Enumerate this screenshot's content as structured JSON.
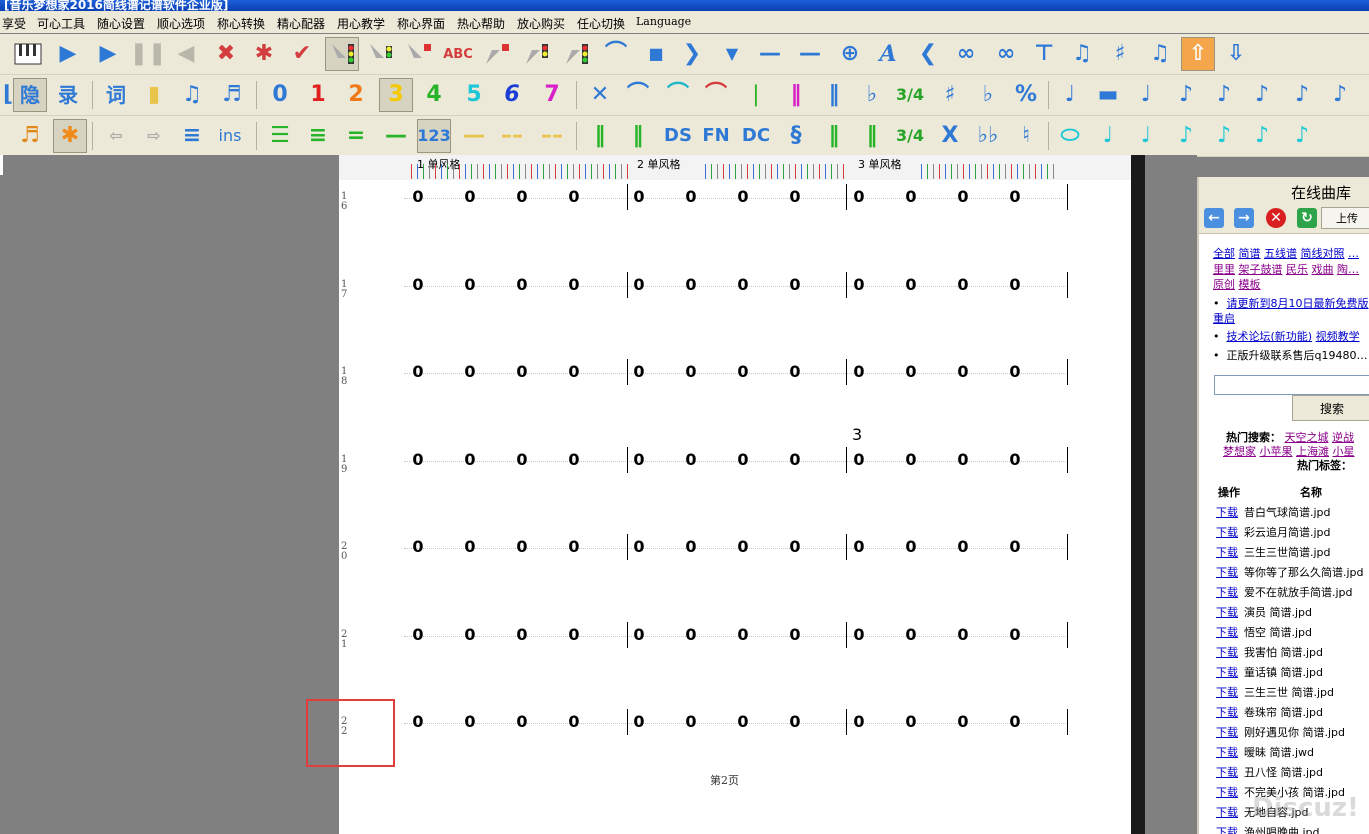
{
  "window_title": "[音乐梦想家2016简线谱记谱软件企业版]",
  "menu": [
    "享受",
    "可心工具",
    "随心设置",
    "顺心选项",
    "称心转换",
    "精心配器",
    "用心教学",
    "称心界面",
    "热心帮助",
    "放心购买",
    "任心切换",
    "Language"
  ],
  "toolbar_text": {
    "note_digits": [
      "0",
      "1",
      "2",
      "3",
      "4",
      "5",
      "6",
      "7"
    ],
    "yin_label": "隐",
    "lu_label": "录",
    "ci_label": "词",
    "ins_label": "ins",
    "num_label": "123",
    "abc_label": "ABC",
    "ds_label": "DS",
    "fn_label": "FN",
    "dc_label": "DC",
    "time_sig": "3/4",
    "x_label": "X"
  },
  "ruler": {
    "labels": [
      "1 单风格",
      "2 单风格",
      "3 单风格"
    ]
  },
  "score": {
    "rows": [
      {
        "num_top": "1",
        "num_bottom": "6",
        "notes": [
          "0",
          "0",
          "0",
          "0",
          "0",
          "0",
          "0",
          "0",
          "0",
          "0",
          "0",
          "0"
        ]
      },
      {
        "num_top": "1",
        "num_bottom": "7",
        "notes": [
          "0",
          "0",
          "0",
          "0",
          "0",
          "0",
          "0",
          "0",
          "0",
          "0",
          "0",
          "0"
        ]
      },
      {
        "num_top": "1",
        "num_bottom": "8",
        "notes": [
          "0",
          "0",
          "0",
          "0",
          "0",
          "0",
          "0",
          "0",
          "0",
          "0",
          "0",
          "0"
        ]
      },
      {
        "num_top": "1",
        "num_bottom": "9",
        "notes": [
          "0",
          "0",
          "0",
          "0",
          "0",
          "0",
          "0",
          "0",
          "0",
          "0",
          "0",
          "0"
        ]
      },
      {
        "num_top": "2",
        "num_bottom": "0",
        "notes": [
          "0",
          "0",
          "0",
          "0",
          "0",
          "0",
          "0",
          "0",
          "0",
          "0",
          "0",
          "0"
        ]
      },
      {
        "num_top": "2",
        "num_bottom": "1",
        "notes": [
          "0",
          "0",
          "0",
          "0",
          "0",
          "0",
          "0",
          "0",
          "0",
          "0",
          "0",
          "0"
        ]
      },
      {
        "num_top": "2",
        "num_bottom": "2",
        "notes": [
          "0",
          "0",
          "0",
          "0",
          "0",
          "0",
          "0",
          "0",
          "0",
          "0",
          "0",
          "0"
        ]
      }
    ],
    "annotation": "3",
    "page_label": "第2页"
  },
  "right_panel": {
    "title": "在线曲库",
    "upload_label": "上传",
    "categories_line1": [
      "全部",
      "简谱",
      "五线谱",
      "简线对照",
      "…"
    ],
    "categories_line2": [
      "里里",
      "架子鼓谱",
      "民乐",
      "戏曲",
      "陶…"
    ],
    "categories_line3": [
      "原创",
      "模板"
    ],
    "bullet1": "请更新到8月10日最新免费版",
    "bullet1_cont": "重启",
    "bullet2_a": "技术论坛(新功能)",
    "bullet2_b": "视频教学",
    "bullet3": "正版升级联系售后q19480…",
    "search_button": "搜索",
    "hot_search_label": "热门搜索：",
    "hot_search_1": [
      "天空之城",
      "逆战"
    ],
    "hot_search_2": [
      "梦想家",
      "小苹果",
      "上海滩",
      "小星"
    ],
    "hot_tags_label": "热门标签：",
    "col_action": "操作",
    "col_name": "名称",
    "download_label": "下载",
    "files": [
      "昔白气球简谱.jpd",
      "彩云追月简谱.jpd",
      "三生三世简谱.jpd",
      "等你等了那么久简谱.jpd",
      "爱不在就放手简谱.jpd",
      "演员 简谱.jpd",
      "悟空 简谱.jpd",
      "我害怕 简谱.jpd",
      "童话镇 简谱.jpd",
      "三生三世 简谱.jpd",
      "卷珠帘 简谱.jpd",
      "刚好遇见你 简谱.jpd",
      "暧昧 简谱.jwd",
      "丑八怪 简谱.jpd",
      "不完美小孩 简谱.jpd",
      "无地自容.jpd",
      "渔州唱晚曲.jpd"
    ]
  },
  "watermark": "Discuz!",
  "colors": {
    "title_bar": "#0a3fb4",
    "highlight_box": "#e23d3d",
    "link": "#0000cc"
  }
}
